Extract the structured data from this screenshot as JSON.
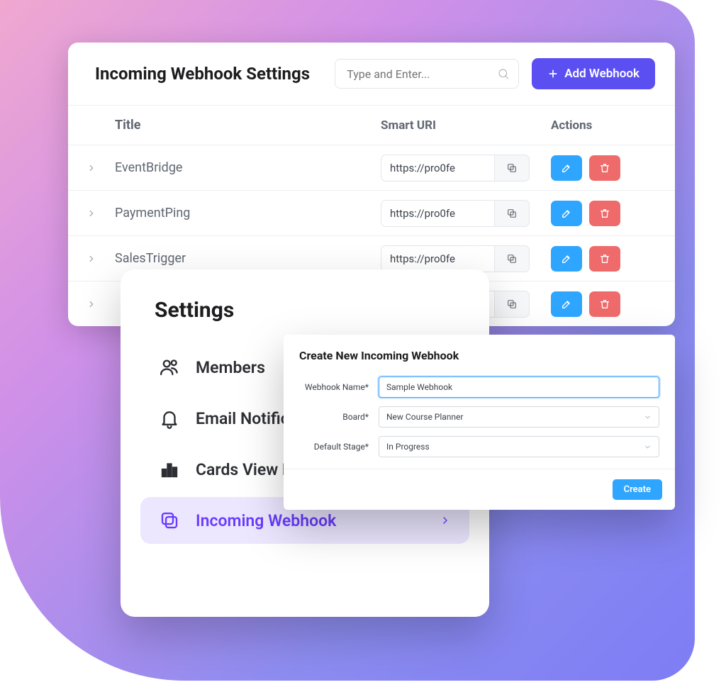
{
  "table": {
    "title": "Incoming Webhook Settings",
    "search_placeholder": "Type and Enter...",
    "add_button": "Add Webhook",
    "headers": {
      "title": "Title",
      "url": "Smart URI",
      "actions": "Actions"
    },
    "rows": [
      {
        "title": "EventBridge",
        "url": "https://pro0fe"
      },
      {
        "title": "PaymentPing",
        "url": "https://pro0fe"
      },
      {
        "title": "SalesTrigger",
        "url": "https://pro0fe"
      },
      {
        "title": "",
        "url": ""
      }
    ]
  },
  "settings": {
    "title": "Settings",
    "items": [
      {
        "label": "Members"
      },
      {
        "label": "Email Notifications"
      },
      {
        "label": "Cards View Preference"
      },
      {
        "label": "Incoming Webhook"
      }
    ]
  },
  "modal": {
    "title": "Create New Incoming Webhook",
    "name_label": "Webhook Name*",
    "name_value": "Sample Webhook",
    "board_label": "Board*",
    "board_value": "New Course Planner",
    "stage_label": "Default Stage*",
    "stage_value": "In Progress",
    "create": "Create"
  }
}
